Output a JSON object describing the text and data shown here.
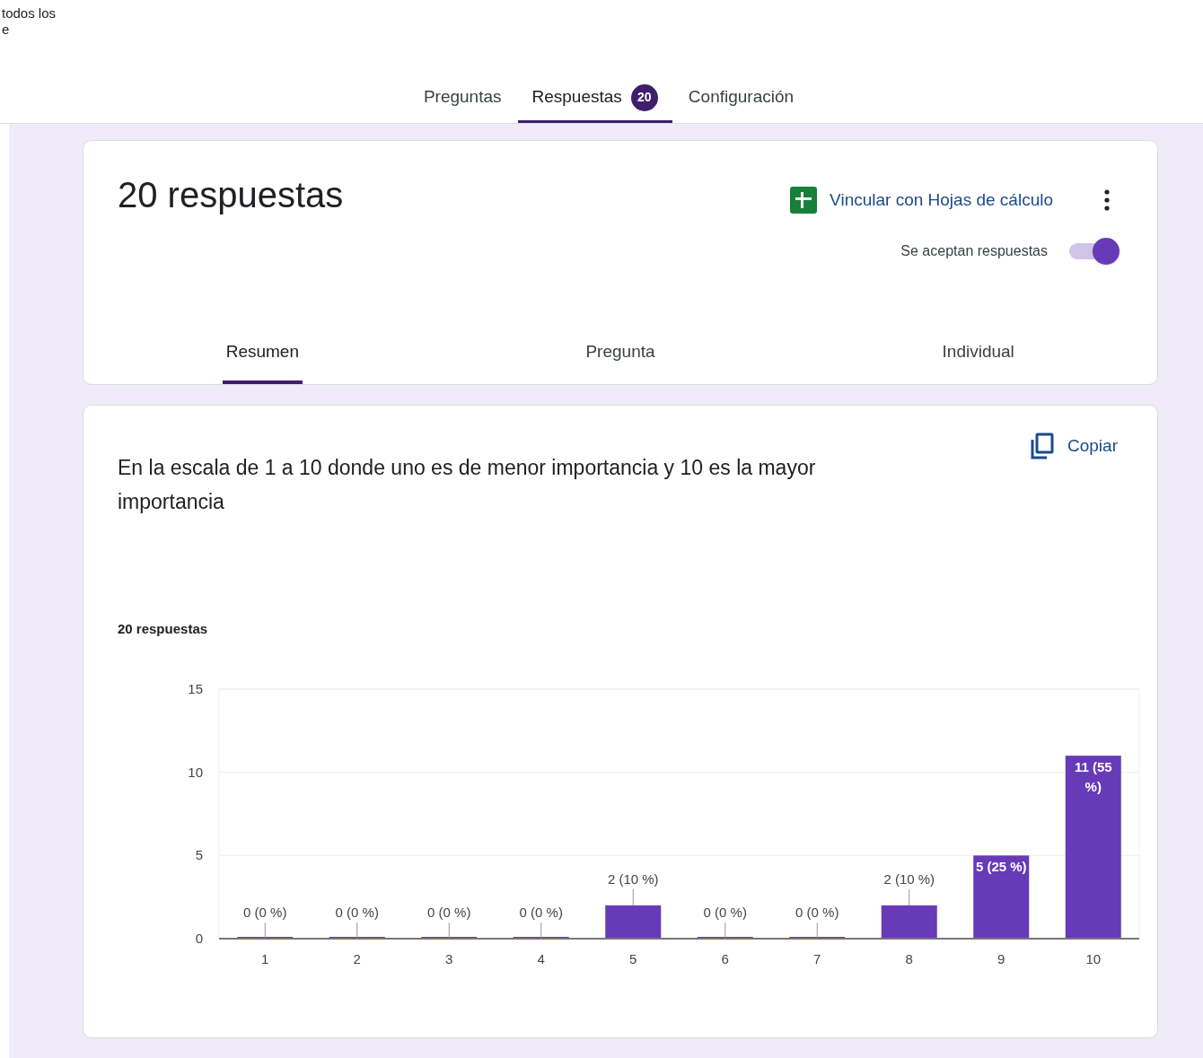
{
  "fragment": {
    "lines": [
      "todos los",
      "e"
    ]
  },
  "tabs": [
    {
      "label": "Preguntas",
      "selected": false
    },
    {
      "label": "Respuestas",
      "selected": true,
      "badge": "20"
    },
    {
      "label": "Configuración",
      "selected": false
    }
  ],
  "summary_card": {
    "title": "20 respuestas",
    "link_sheets": "Vincular con Hojas de cálculo",
    "accepting_label": "Se aceptan respuestas",
    "accepting": true,
    "subtabs": [
      {
        "label": "Resumen",
        "selected": true
      },
      {
        "label": "Pregunta",
        "selected": false
      },
      {
        "label": "Individual",
        "selected": false
      }
    ]
  },
  "question_card": {
    "copy": "Copiar",
    "question": "En la escala de 1 a 10 donde uno es de menor importancia y 10 es la mayor importancia",
    "count": "20 respuestas",
    "chart_data": {
      "type": "bar",
      "categories": [
        "1",
        "2",
        "3",
        "4",
        "5",
        "6",
        "7",
        "8",
        "9",
        "10"
      ],
      "series": [
        {
          "color": "#673ab7",
          "values": [
            0,
            0,
            0,
            0,
            2,
            0,
            0,
            2,
            5,
            11
          ]
        }
      ],
      "ylim": [
        0,
        15
      ],
      "yticks": [
        0,
        5,
        10,
        15
      ],
      "value_labels": [
        "0 (0 %)",
        "0 (0 %)",
        "0 (0 %)",
        "0 (0 %)",
        "2 (10 %)",
        "0 (0 %)",
        "0 (0 %)",
        "2 (10 %)",
        "5 (25 %)",
        "11 (55 %)"
      ]
    }
  }
}
